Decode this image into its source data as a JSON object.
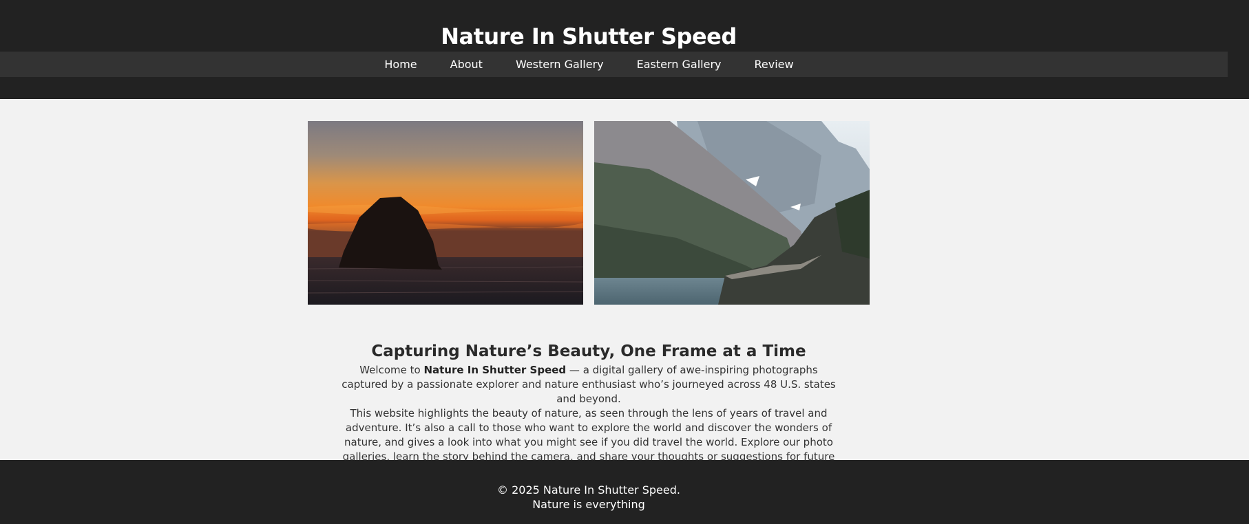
{
  "site": {
    "title": "Nature In Shutter Speed"
  },
  "nav": {
    "items": [
      "Home",
      "About",
      "Western Gallery",
      "Eastern Gallery",
      "Review"
    ]
  },
  "gallery": {
    "images": [
      "sunset-sea-stack-photo",
      "mountain-lake-photo"
    ]
  },
  "intro": {
    "heading": "Capturing Nature’s Beauty, One Frame at a Time",
    "p1_before": "Welcome to ",
    "p1_bold": "Nature In Shutter Speed",
    "p1_after": " — a digital gallery of awe-inspiring photographs captured by a passionate explorer and nature enthusiast who’s journeyed across 48 U.S. states and beyond.",
    "p2": "This website highlights the beauty of nature, as seen through the lens of years of travel and adventure. It’s also a call to those who want to explore the world and discover the wonders of nature, and gives a look into what you might see if you did travel the world. Explore our photo galleries, learn the story behind the camera, and share your thoughts or suggestions for future destinations."
  },
  "footer": {
    "copyright": "© 2025 Nature In Shutter Speed.",
    "tagline": "Nature is everything"
  },
  "colors": {
    "header_bg": "#222222",
    "nav_bg": "#333333",
    "page_bg": "#f2f2f2"
  }
}
